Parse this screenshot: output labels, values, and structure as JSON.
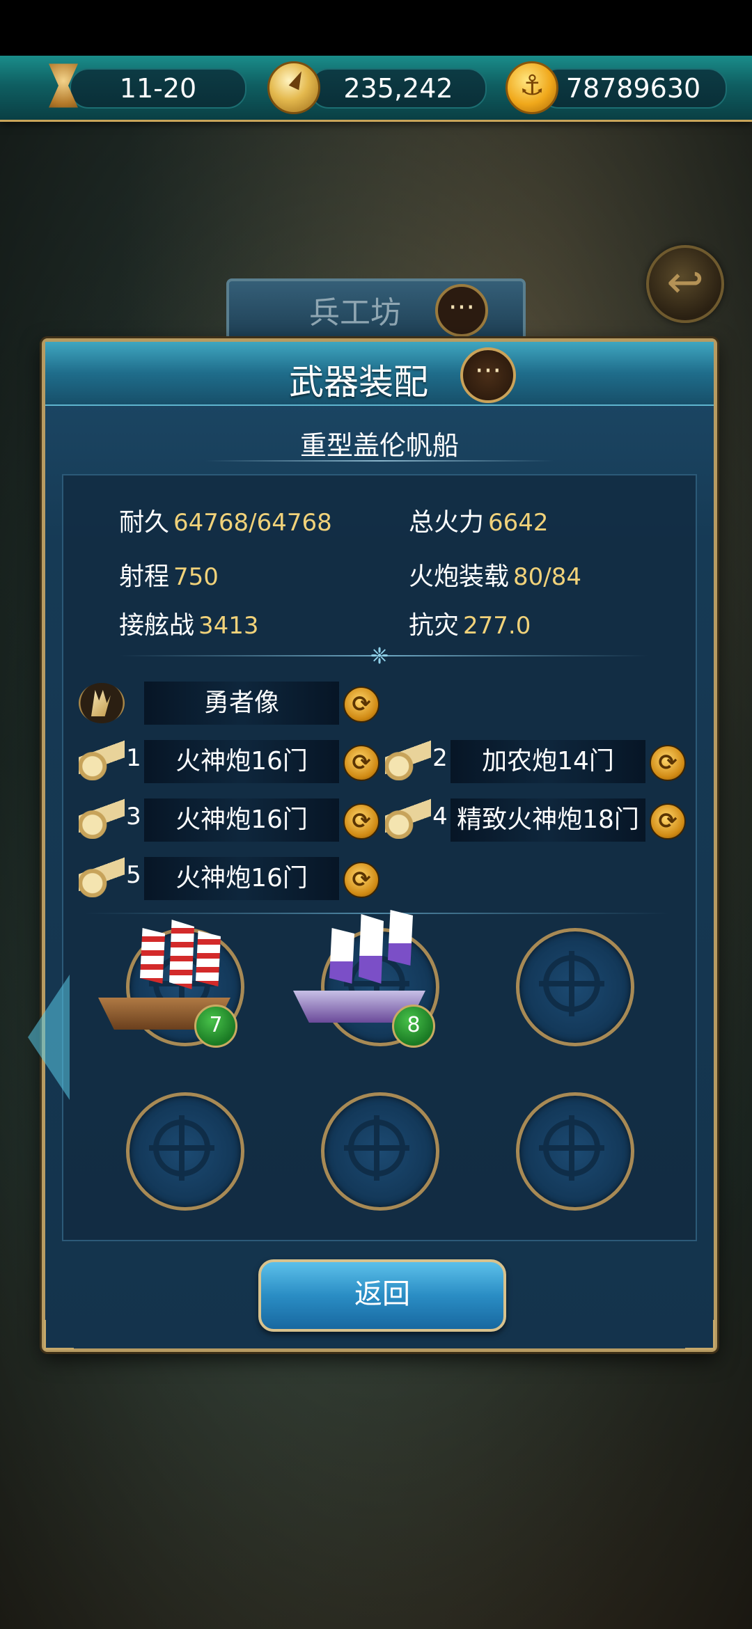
{
  "resources": {
    "time": "11-20",
    "compass": "235,242",
    "gold": "78789630"
  },
  "background_tab": {
    "title": "兵工坊"
  },
  "panel": {
    "title": "武器装配",
    "ship_name": "重型盖伦帆船",
    "stats": [
      {
        "label": "耐久",
        "value": "64768/64768"
      },
      {
        "label": "总火力",
        "value": "6642"
      },
      {
        "label": "射程",
        "value": "750"
      },
      {
        "label": "火炮装载",
        "value": "80/84"
      },
      {
        "label": "接舷战",
        "value": "3413"
      },
      {
        "label": "抗灾",
        "value": "277.0"
      }
    ],
    "figurehead": {
      "label": "勇者像"
    },
    "cannon_slots": [
      {
        "num": "1",
        "label": "火神炮16门"
      },
      {
        "num": "2",
        "label": "加农炮14门"
      },
      {
        "num": "3",
        "label": "火神炮16门"
      },
      {
        "num": "4",
        "label": "精致火神炮18门"
      },
      {
        "num": "5",
        "label": "火神炮16门"
      }
    ],
    "ships": [
      {
        "level": "7"
      },
      {
        "level": "8"
      }
    ],
    "return_label": "返回"
  },
  "icons": {
    "hourglass": "hourglass-icon",
    "compass": "compass-icon",
    "coin": "anchor-coin-icon",
    "back": "back-arrow-icon",
    "chat": "chat-bubble-icon",
    "cannon": "cannon-icon",
    "figurehead": "wing-icon",
    "swap": "swap-icon",
    "empty_slot": "ship-wheel-icon"
  },
  "colors": {
    "stat_value": "#f1d27a",
    "panel_border": "#b79b62",
    "header_teal": "#1a8d8a"
  }
}
